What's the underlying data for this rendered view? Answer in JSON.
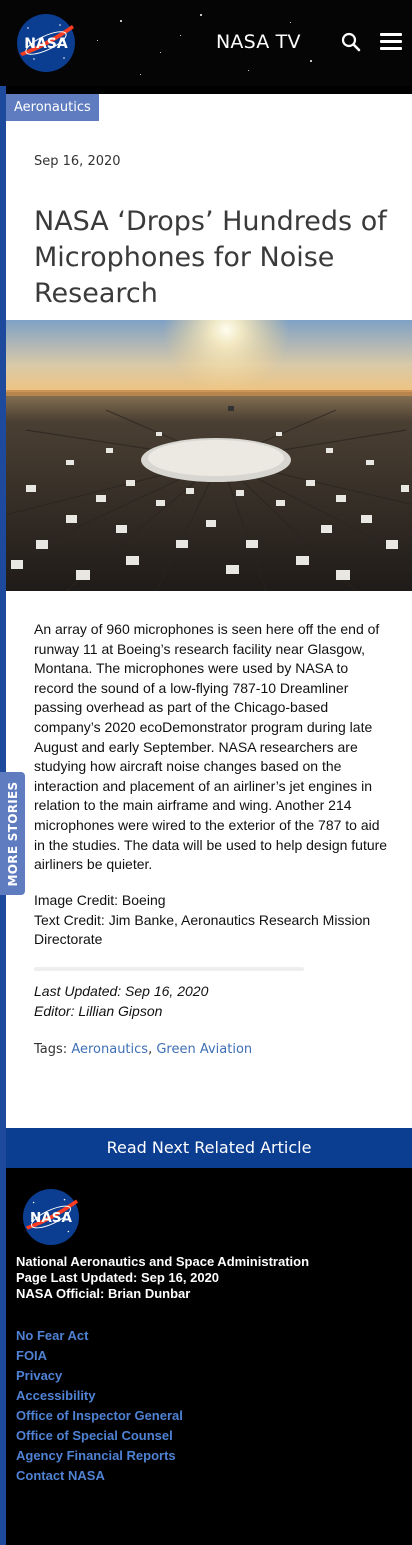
{
  "header": {
    "logo_text": "NASA",
    "nasa_tv": "NASA TV",
    "icons": [
      "search-icon",
      "menu-icon"
    ]
  },
  "article": {
    "category": "Aeronautics",
    "date": "Sep 16, 2020",
    "title": "NASA ‘Drops’ Hundreds of Microphones for Noise Research",
    "caption": "An array of 960 microphones is seen here off the end of runway 11 at Boeing’s research facility near Glasgow, Montana. The microphones were used by NASA to record the sound of a low-flying 787-10 Dreamliner passing overhead as part of the Chicago-based company’s 2020 ecoDemonstrator program during late August and early September. NASA researchers are studying how aircraft noise changes based on the interaction and placement of an airliner’s jet engines in relation to the main airframe and wing. Another 214 microphones were wired to the exterior of the 787 to aid in the studies. The data will be used to help design future airliners be quieter.",
    "image_credit": "Image Credit: Boeing",
    "text_credit": "Text Credit: Jim Banke, Aeronautics Research Mission Directorate",
    "last_updated": "Last Updated: Sep 16, 2020",
    "editor": "Editor: Lillian Gipson",
    "tags_label": "Tags:",
    "tags": [
      "Aeronautics",
      "Green Aviation"
    ]
  },
  "more_stories": "MORE STORIES",
  "read_next": "Read Next Related Article",
  "footer": {
    "org": "National Aeronautics and Space Administration",
    "page_updated": "Page Last Updated: Sep 16, 2020",
    "official": "NASA Official: Brian Dunbar",
    "links": [
      "No Fear Act",
      "FOIA",
      "Privacy",
      "Accessibility",
      "Office of Inspector General",
      "Office of Special Counsel",
      "Agency Financial Reports",
      "Contact NASA"
    ]
  },
  "colors": {
    "nasa_blue": "#0b3d91",
    "tag_blue": "#5f7cc0",
    "link_blue": "#4f82d4",
    "nasa_red": "#fc3d21"
  }
}
